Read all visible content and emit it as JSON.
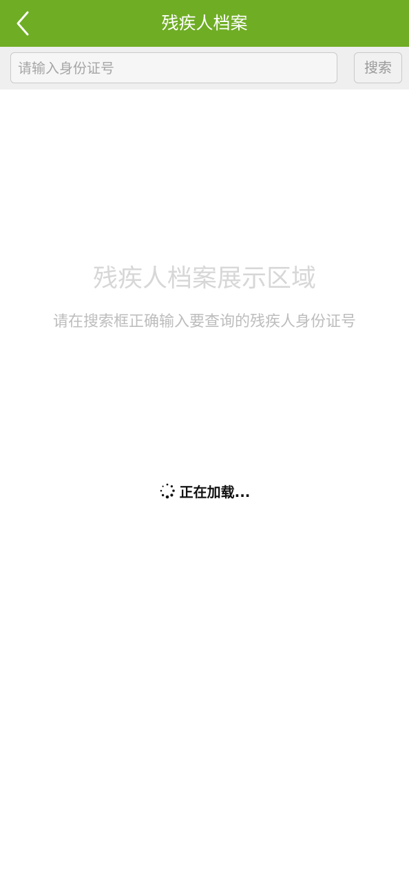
{
  "header": {
    "title": "残疾人档案",
    "back_icon": "chevron-left-icon",
    "background_color": "#6fad24"
  },
  "search": {
    "placeholder": "请输入身份证号",
    "value": "",
    "button_label": "搜索"
  },
  "content": {
    "placeholder_title": "残疾人档案展示区域",
    "placeholder_hint": "请在搜索框正确输入要查询的残疾人身份证号"
  },
  "loading": {
    "icon": "spinner-icon",
    "text": "正在加载..."
  }
}
